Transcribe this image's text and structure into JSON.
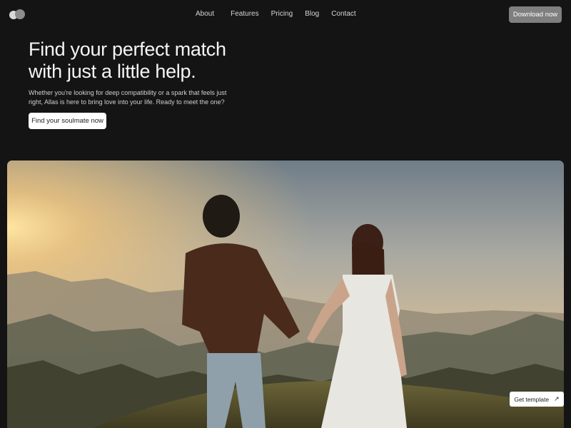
{
  "logo": {
    "icon": "toggle-logo-icon"
  },
  "nav": {
    "items": [
      "About",
      "Features",
      "Pricing",
      "Blog",
      "Contact"
    ]
  },
  "header": {
    "download_label": "Download now"
  },
  "hero": {
    "title_line1": "Find your perfect match",
    "title_line2": "with just a little help.",
    "subtitle": "Whether you're looking for deep compatibility or a spark that feels just right, Allas is here to bring love into your life. Ready to meet the one?",
    "cta_label": "Find your soulmate now"
  },
  "image": {
    "icon": "couple-sunset-photo"
  },
  "template_button": {
    "label": "Get template",
    "icon": "arrow-up-right-icon",
    "arrow_glyph": "↗"
  },
  "colors": {
    "background": "#141414",
    "download_button": "#7f7f7f",
    "cta_button": "#ffffff"
  }
}
